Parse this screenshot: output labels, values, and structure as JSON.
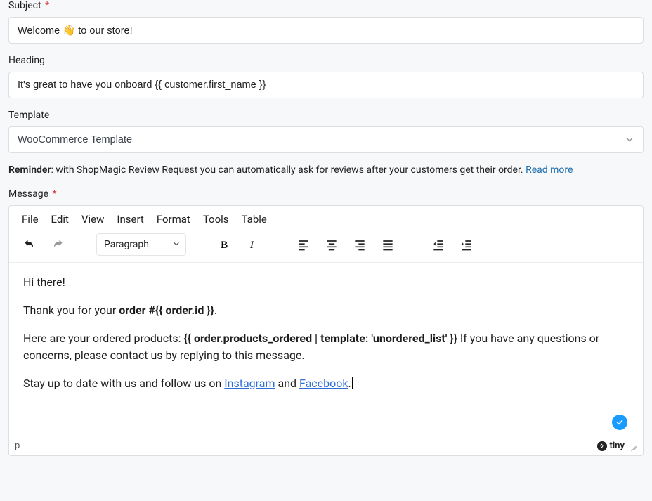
{
  "subject": {
    "label": "Subject",
    "required": "*",
    "value": "Welcome 👋 to our store!"
  },
  "heading": {
    "label": "Heading",
    "value": "It's great to have you onboard {{ customer.first_name }}"
  },
  "template": {
    "label": "Template",
    "selected": "WooCommerce Template"
  },
  "reminder": {
    "bold": "Reminder",
    "text": ": with ShopMagic Review Request you can automatically ask for reviews after your customers get their order. ",
    "link": "Read more"
  },
  "message": {
    "label": "Message",
    "required": "*"
  },
  "editor": {
    "menubar": [
      "File",
      "Edit",
      "View",
      "Insert",
      "Format",
      "Tools",
      "Table"
    ],
    "paragraph_label": "Paragraph",
    "body": {
      "p1": "Hi there!",
      "p2_a": "Thank you for your ",
      "p2_b": "order #{{ order.id }}",
      "p2_c": ".",
      "p3_a": "Here are your ordered products: ",
      "p3_b": "{{ order.products_ordered | template: 'unordered_list' }}",
      "p3_c": " If you have any questions or concerns, please contact us by replying to this message.",
      "p4_a": "Stay up to date with us and follow us on ",
      "p4_link1": "Instagram",
      "p4_b": " and ",
      "p4_link2": "Facebook",
      "p4_c": "."
    },
    "status_path": "p",
    "branding": "tiny"
  }
}
